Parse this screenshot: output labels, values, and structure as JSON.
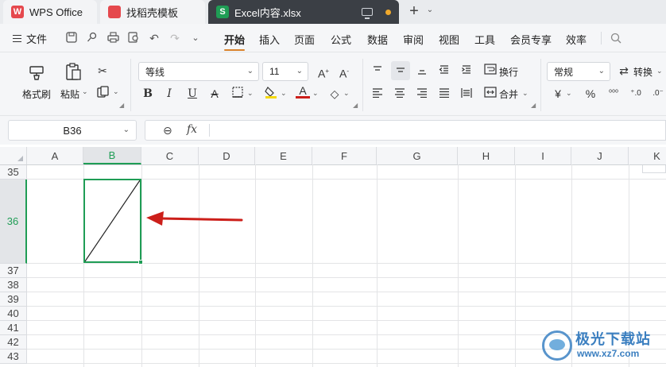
{
  "tabs": {
    "wps": "WPS Office",
    "template": "找稻壳模板",
    "excel": "Excel内容.xlsx",
    "excel_icon": "S",
    "wps_icon": "W"
  },
  "menu": {
    "file": "文件",
    "items": [
      "开始",
      "插入",
      "页面",
      "公式",
      "数据",
      "审阅",
      "视图",
      "工具",
      "会员专享",
      "效率"
    ],
    "active": "开始"
  },
  "ribbon": {
    "format_painter": "格式刷",
    "paste": "粘贴",
    "font_name": "等线",
    "font_size": "11",
    "wrap": "换行",
    "merge": "合并",
    "number_format": "常规",
    "convert": "转换",
    "currency": "¥",
    "percent": "%"
  },
  "formula_bar": {
    "name_box": "B36",
    "fx": "fx",
    "content": ""
  },
  "sheet": {
    "columns": [
      "A",
      "B",
      "C",
      "D",
      "E",
      "F",
      "G",
      "H",
      "I",
      "J",
      "K"
    ],
    "rows": [
      "35",
      "36",
      "37",
      "38",
      "39",
      "40",
      "41",
      "42",
      "43"
    ],
    "selected_cell": "B36",
    "selected_cell_content": "diagonal line"
  },
  "watermark": {
    "title": "极光下载站",
    "url": "www.xz7.com"
  },
  "colors": {
    "accent_green": "#1f9d55",
    "tab_active_bg": "#3b3f45",
    "menu_underline": "#d9822b",
    "arrow_red": "#cc1f1a"
  }
}
